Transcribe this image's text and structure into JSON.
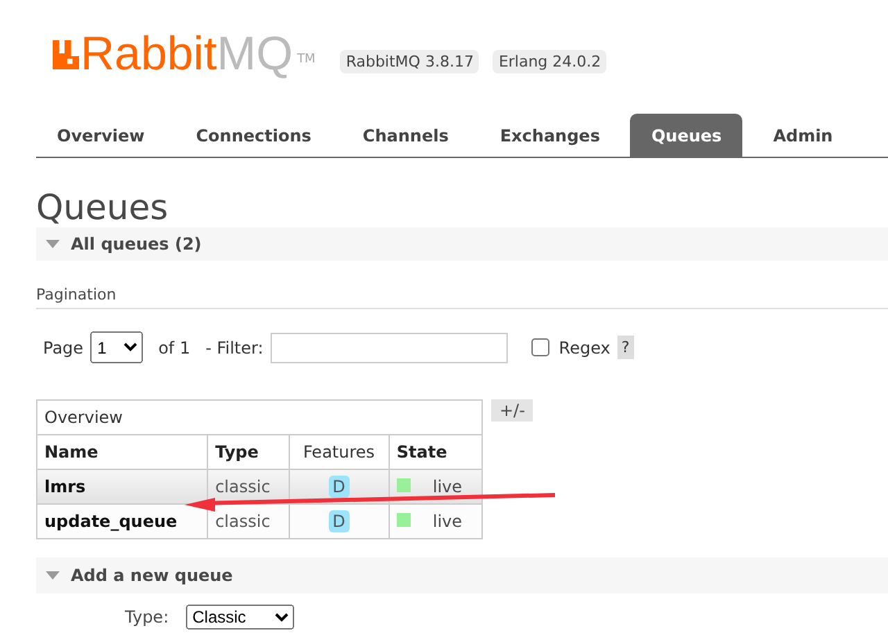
{
  "header": {
    "logo": {
      "brand": "Rabbit",
      "suffix": "MQ",
      "mark": "TM"
    },
    "badges": [
      "RabbitMQ 3.8.17",
      "Erlang 24.0.2"
    ]
  },
  "tabs": [
    {
      "label": "Overview",
      "selected": false
    },
    {
      "label": "Connections",
      "selected": false
    },
    {
      "label": "Channels",
      "selected": false
    },
    {
      "label": "Exchanges",
      "selected": false
    },
    {
      "label": "Queues",
      "selected": true
    },
    {
      "label": "Admin",
      "selected": false
    }
  ],
  "title": "Queues",
  "all_queues": {
    "label": "All queues (2)",
    "expanded": true
  },
  "pagination": {
    "heading": "Pagination",
    "page_label": "Page",
    "page": "1",
    "of": "of 1",
    "filter_label": "- Filter:",
    "regex_label": "Regex",
    "regex_checked": false,
    "help": "?"
  },
  "table": {
    "group": "Overview",
    "toggle": "+/-",
    "columns": [
      "Name",
      "Type",
      "Features",
      "State"
    ],
    "rows": [
      {
        "name": "lmrs",
        "type": "classic",
        "feature": "D",
        "state": "live"
      },
      {
        "name": "update_queue",
        "type": "classic",
        "feature": "D",
        "state": "live"
      }
    ]
  },
  "add_queue": {
    "label": "Add a new queue",
    "expanded": true,
    "type_label": "Type:",
    "type_value": "Classic"
  }
}
